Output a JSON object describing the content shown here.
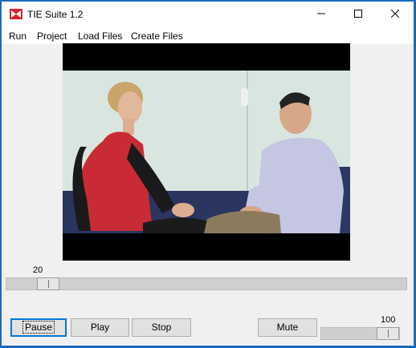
{
  "window": {
    "title": "TIE Suite 1.2"
  },
  "menu": {
    "items": [
      "Run",
      "Project",
      "Load Files",
      "Create Files"
    ]
  },
  "video": {
    "description_icon": "video-frame"
  },
  "position_slider": {
    "value_label": "20",
    "fraction": 0.08
  },
  "volume_slider": {
    "value_label": "100",
    "fraction": 1.0
  },
  "controls": {
    "pause": "Pause",
    "play": "Play",
    "stop": "Stop",
    "mute": "Mute"
  },
  "colors": {
    "accent": "#0078d7",
    "app_icon": "#d9232e",
    "desktop": "#1e63b8"
  }
}
